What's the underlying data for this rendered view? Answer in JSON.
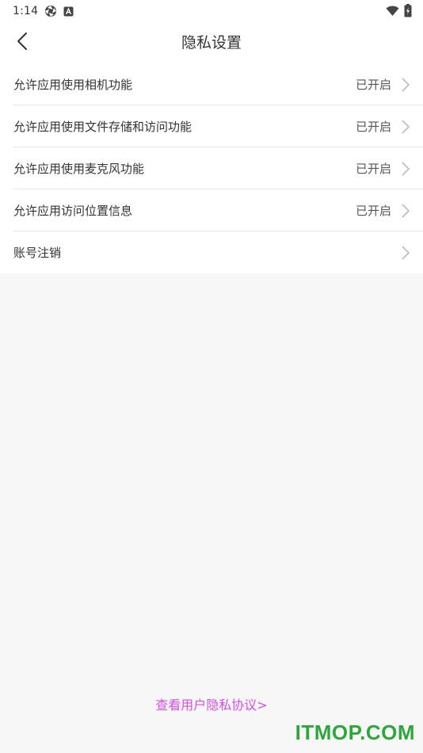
{
  "status_bar": {
    "time": "1:14",
    "icons": [
      "aperture-icon",
      "a-badge-icon",
      "wifi-icon",
      "battery-charging-icon"
    ]
  },
  "header": {
    "title": "隐私设置",
    "back_icon": "chevron-left-icon"
  },
  "settings": [
    {
      "label": "允许应用使用相机功能",
      "status": "已开启"
    },
    {
      "label": "允许应用使用文件存储和访问功能",
      "status": "已开启"
    },
    {
      "label": "允许应用使用麦克风功能",
      "status": "已开启"
    },
    {
      "label": "允许应用访问位置信息",
      "status": "已开启"
    },
    {
      "label": "账号注销",
      "status": ""
    }
  ],
  "footer": {
    "agreement_link": "查看用户隐私协议>"
  },
  "watermark": "ITMOP.COM",
  "colors": {
    "link": "#d44fe6",
    "watermark": "#2ea63a",
    "background": "#f7f7f7"
  }
}
